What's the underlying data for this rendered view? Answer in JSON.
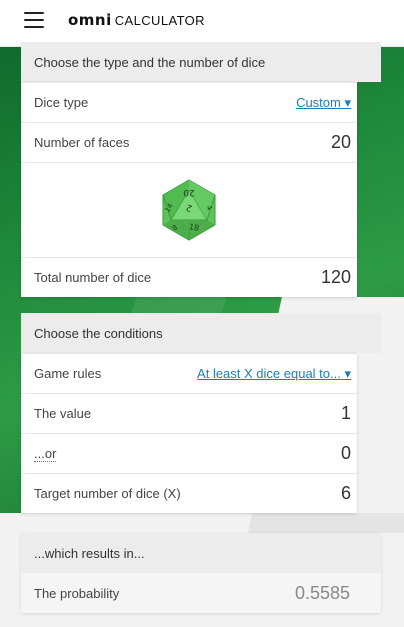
{
  "header": {
    "logo_primary": "omni",
    "logo_secondary": "CALCULATOR"
  },
  "dice_section": {
    "title": "Choose the type and the number of dice",
    "dice_type_label": "Dice type",
    "dice_type_value": "Custom ▾",
    "faces_label": "Number of faces",
    "faces_value": "20",
    "dice_image_numbers": [
      "20",
      "2",
      "14",
      "4",
      "18",
      "8"
    ],
    "total_label": "Total number of dice",
    "total_value": "120"
  },
  "conditions_section": {
    "title": "Choose the conditions",
    "rules_label": "Game rules",
    "rules_value": "At least X dice equal to... ▾",
    "value_label": "The value",
    "value_value": "1",
    "or_label": "...or",
    "or_value": "0",
    "target_label": "Target number of dice (X)",
    "target_value": "6"
  },
  "results_section": {
    "title": "...which results in...",
    "probability_label": "The probability",
    "probability_value": "0.5585"
  },
  "colors": {
    "brand_green": "#1f8a3c",
    "link_blue": "#1a7fb5",
    "dice_green": "#6cd06a"
  }
}
